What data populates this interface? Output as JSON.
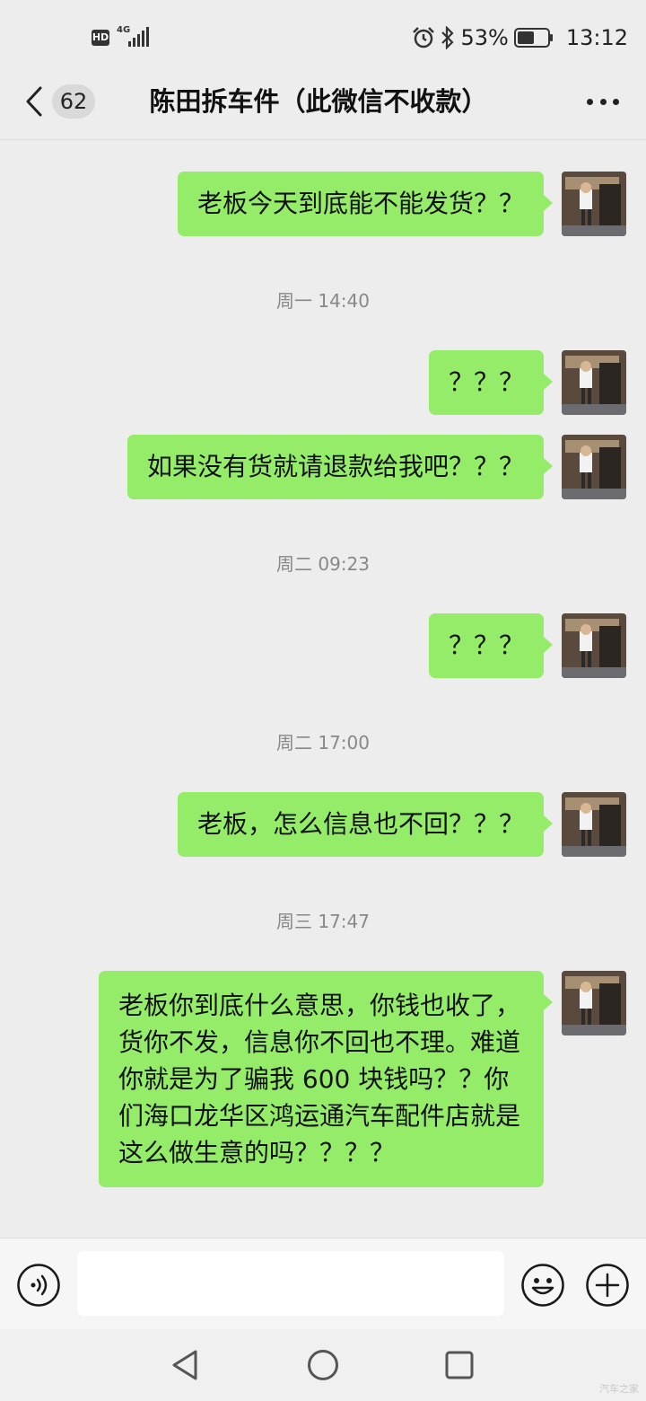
{
  "status_bar": {
    "hd": "HD",
    "network": "4G",
    "battery_percent": "53%",
    "time": "13:12"
  },
  "nav": {
    "unread_count": "62",
    "title": "陈田拆车件（此微信不收款）"
  },
  "messages": [
    {
      "type": "sent",
      "text": "老板今天到底能不能发货？？"
    },
    {
      "type": "time",
      "text": "周一 14:40"
    },
    {
      "type": "sent",
      "text": "？？？"
    },
    {
      "type": "sent",
      "text": "如果没有货就请退款给我吧？？？"
    },
    {
      "type": "time",
      "text": "周二 09:23"
    },
    {
      "type": "sent",
      "text": "？？？"
    },
    {
      "type": "time",
      "text": "周二 17:00"
    },
    {
      "type": "sent",
      "text": "老板，怎么信息也不回？？？"
    },
    {
      "type": "time",
      "text": "周三 17:47"
    },
    {
      "type": "sent",
      "text": "老板你到底什么意思，你钱也收了，货你不发，信息你不回也不理。难道你就是为了骗我 600 块钱吗？？你们海口龙华区鸿运通汽车配件店就是这么做生意的吗？？？？"
    }
  ],
  "input": {
    "value": ""
  },
  "icons": {
    "back": "chevron-left-icon",
    "more": "more-dots-icon",
    "voice": "voice-icon",
    "emoji": "emoji-icon",
    "plus": "plus-icon",
    "alarm": "alarm-icon",
    "bluetooth": "bluetooth-icon",
    "battery": "battery-icon"
  },
  "colors": {
    "sent_bubble": "#95ec69",
    "background": "#ededed",
    "time_label": "#888888"
  },
  "watermark": "汽车之家"
}
